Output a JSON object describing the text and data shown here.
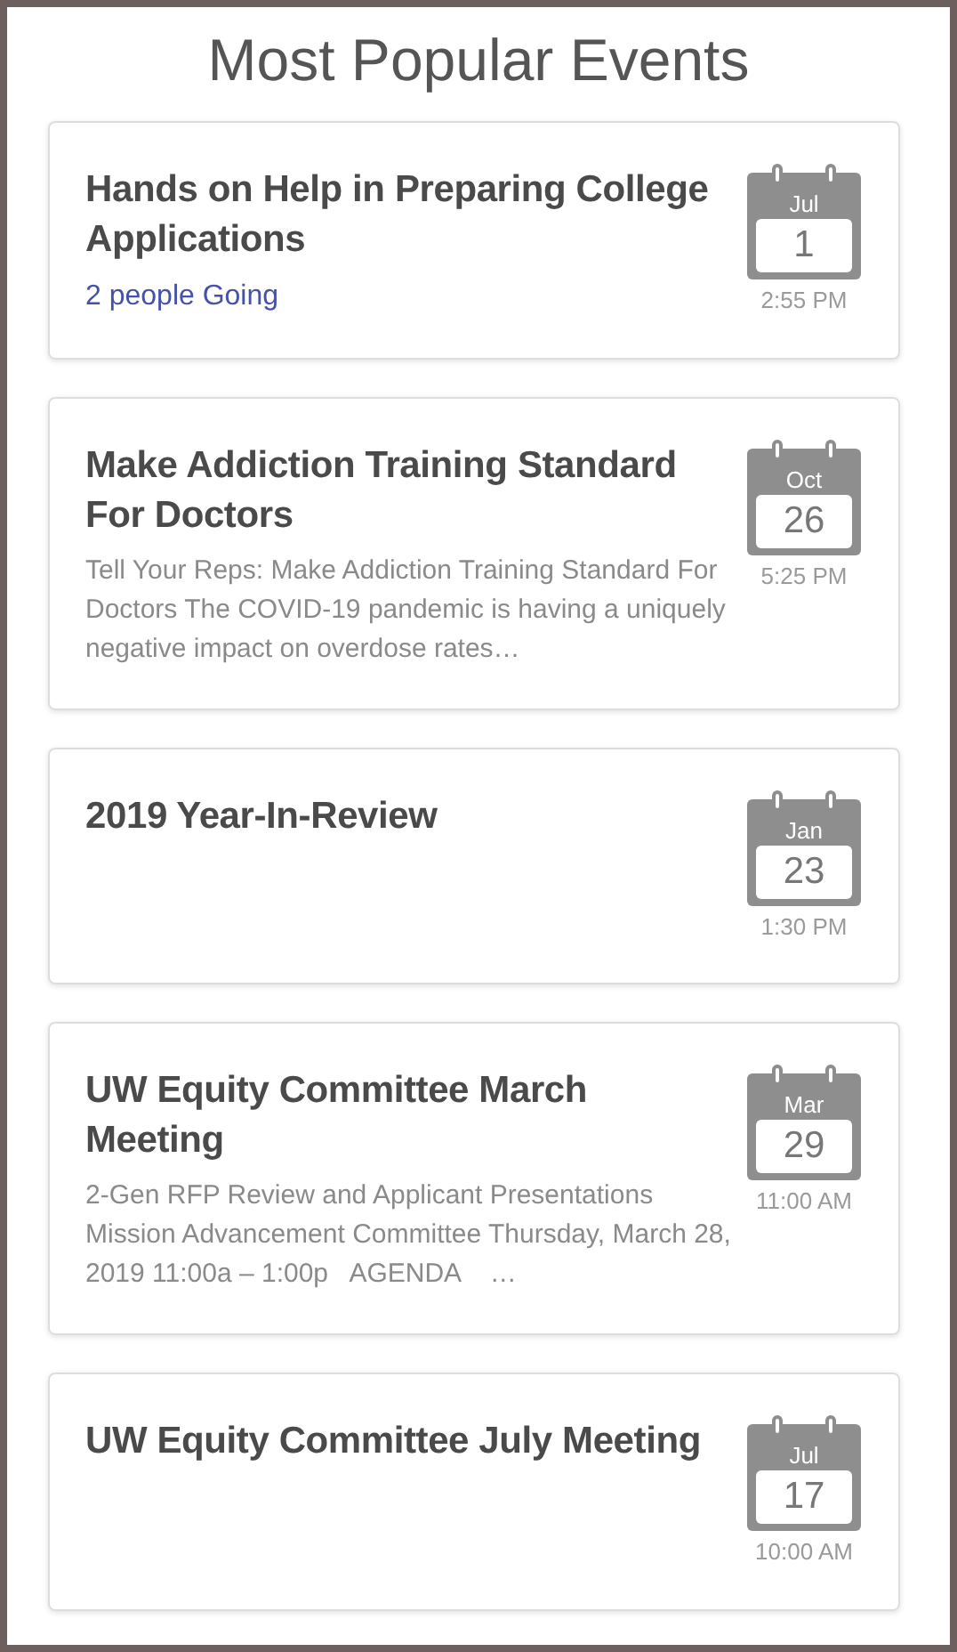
{
  "heading": "Most Popular Events",
  "events": [
    {
      "title": "Hands on Help in Preparing College Applications",
      "attendance": "2 people Going",
      "month": "Jul",
      "day": "1",
      "time": "2:55 PM"
    },
    {
      "title": "Make Addiction Training Standard For Doctors",
      "description": "Tell Your Reps: Make Addiction Training Standard For Doctors The COVID-19 pandemic is having a uniquely negative impact on overdose rates…",
      "month": "Oct",
      "day": "26",
      "time": "5:25 PM"
    },
    {
      "title": "2019 Year-In-Review",
      "month": "Jan",
      "day": "23",
      "time": "1:30 PM"
    },
    {
      "title": "UW Equity Committee March Meeting",
      "description": "2-Gen RFP Review and Applicant Presentations Mission Advancement Committee Thursday, March 28, 2019 11:00a – 1:00p   AGENDA    …",
      "month": "Mar",
      "day": "29",
      "time": "11:00 AM"
    },
    {
      "title": "UW Equity Committee July Meeting",
      "month": "Jul",
      "day": "17",
      "time": "10:00 AM"
    }
  ]
}
